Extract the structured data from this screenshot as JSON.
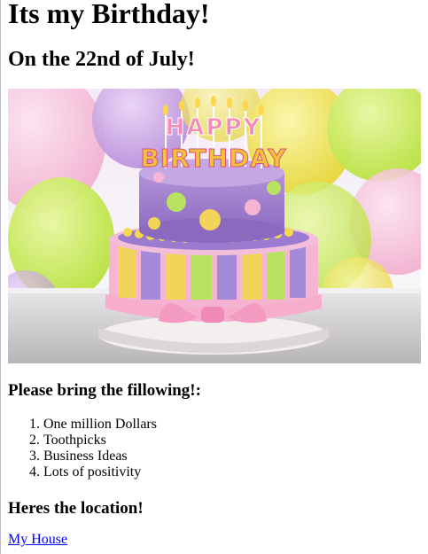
{
  "header": {
    "title": "Its my Birthday!",
    "subtitle": "On the 22nd of July!"
  },
  "hero_image": {
    "alt": "Birthday cake",
    "cake_topper_top": "HAPPY",
    "cake_topper_bottom": "BIRTHDAY"
  },
  "bring_section": {
    "heading": "Please bring the fillowing!:",
    "items": [
      "One million Dollars",
      "Toothpicks",
      "Business Ideas",
      "Lots of positivity"
    ]
  },
  "location_section": {
    "heading": "Heres the location!",
    "link_text": "My House"
  },
  "colors": {
    "link": "#0000ee",
    "text": "#000000",
    "background": "#ffffff"
  }
}
